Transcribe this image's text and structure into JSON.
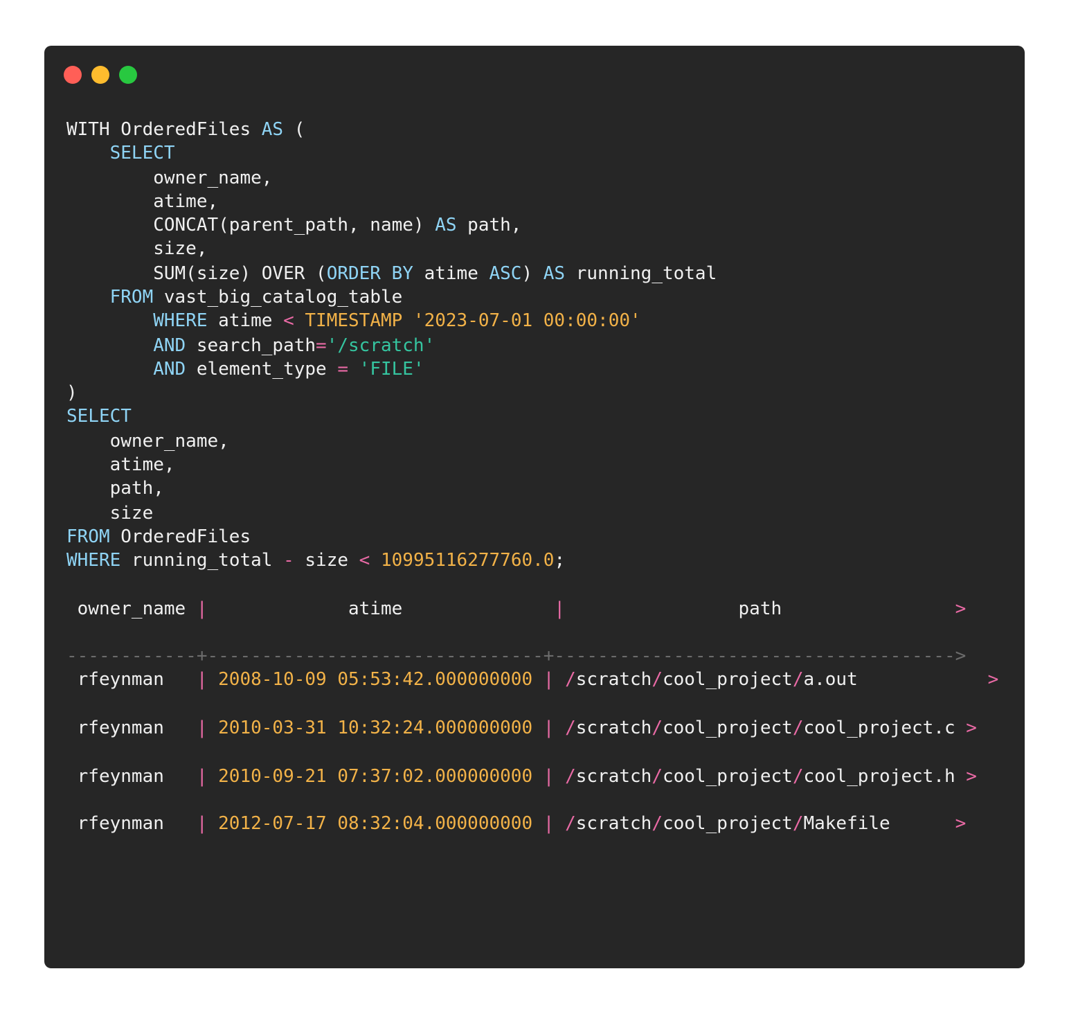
{
  "window": {
    "buttons": [
      {
        "name": "close",
        "color": "#ff5f57"
      },
      {
        "name": "minimize",
        "color": "#febc2e"
      },
      {
        "name": "zoom",
        "color": "#28c840"
      }
    ]
  },
  "colors": {
    "background": "#262626",
    "text": "#f0f0f0",
    "keyword": "#8fd4f5",
    "operator": "#e96aa5",
    "number": "#f2b248",
    "string": "#35c5a0"
  },
  "query": {
    "l01": {
      "a": "WITH OrderedFiles ",
      "b": "AS",
      "c": " ("
    },
    "l02": {
      "a": "    ",
      "b": "SELECT"
    },
    "l03": {
      "a": "        owner_name,"
    },
    "l04": {
      "a": "        atime,"
    },
    "l05": {
      "a": "        CONCAT(parent_path, name) ",
      "b": "AS",
      "c": " path,"
    },
    "l06": {
      "a": "        size,"
    },
    "l07": {
      "a": "        SUM(size) OVER (",
      "b": "ORDER BY",
      "c": " atime ",
      "d": "ASC",
      "e": ") ",
      "f": "AS",
      "g": " running_total"
    },
    "l08": {
      "a": "    ",
      "b": "FROM",
      "c": " vast_big_catalog_table"
    },
    "l09": {
      "a": "        ",
      "b": "WHERE",
      "c": " atime ",
      "d": "<",
      "e": " TIMESTAMP '2023-07-01 00:00:00'"
    },
    "l10": {
      "a": "        ",
      "b": "AND",
      "c": " search_path",
      "d": "=",
      "e": "'/scratch'"
    },
    "l11": {
      "a": "        ",
      "b": "AND",
      "c": " element_type ",
      "d": "=",
      "e": " ",
      "f": "'FILE'"
    },
    "l12": {
      "a": ")"
    },
    "l13": {
      "b": "SELECT"
    },
    "l14": {
      "a": "    owner_name,"
    },
    "l15": {
      "a": "    atime,"
    },
    "l16": {
      "a": "    path,"
    },
    "l17": {
      "a": "    size"
    },
    "l18": {
      "b": "FROM",
      "c": " OrderedFiles"
    },
    "l19": {
      "b": "WHERE",
      "c": " running_total ",
      "d": "-",
      "e": " size ",
      "f": "<",
      "g": " 10995116277760.0",
      "h": ";"
    }
  },
  "results": {
    "header": {
      "owner_name": " owner_name ",
      "sep1": "|",
      "atime": "             atime              ",
      "sep2": "|",
      "path": "                path                ",
      "more": ">"
    },
    "divider": {
      "a": "------------",
      "b": "+",
      "c": "-------------------------------",
      "d": "+",
      "e": "-------------------------------------",
      "f": ">"
    },
    "rows": [
      {
        "owner": " rfeynman   ",
        "sep1": "|",
        "sp1": " ",
        "atime": "2008-10-09 05:53:42.000000000",
        "sp2": " ",
        "sep2": "|",
        "sp3": " ",
        "p1": "/",
        "p2": "scratch",
        "p3": "/",
        "p4": "cool_project",
        "p5": "/",
        "p6": "a.out",
        "pad": "            ",
        "more": ">"
      },
      {
        "owner": " rfeynman   ",
        "sep1": "|",
        "sp1": " ",
        "atime": "2010-03-31 10:32:24.000000000",
        "sp2": " ",
        "sep2": "|",
        "sp3": " ",
        "p1": "/",
        "p2": "scratch",
        "p3": "/",
        "p4": "cool_project",
        "p5": "/",
        "p6": "cool_project.c",
        "pad": " ",
        "more": ">"
      },
      {
        "owner": " rfeynman   ",
        "sep1": "|",
        "sp1": " ",
        "atime": "2010-09-21 07:37:02.000000000",
        "sp2": " ",
        "sep2": "|",
        "sp3": " ",
        "p1": "/",
        "p2": "scratch",
        "p3": "/",
        "p4": "cool_project",
        "p5": "/",
        "p6": "cool_project.h",
        "pad": " ",
        "more": ">"
      },
      {
        "owner": " rfeynman   ",
        "sep1": "|",
        "sp1": " ",
        "atime": "2012-07-17 08:32:04.000000000",
        "sp2": " ",
        "sep2": "|",
        "sp3": " ",
        "p1": "/",
        "p2": "scratch",
        "p3": "/",
        "p4": "cool_project",
        "p5": "/",
        "p6": "Makefile",
        "pad": "      ",
        "more": ">"
      }
    ]
  }
}
